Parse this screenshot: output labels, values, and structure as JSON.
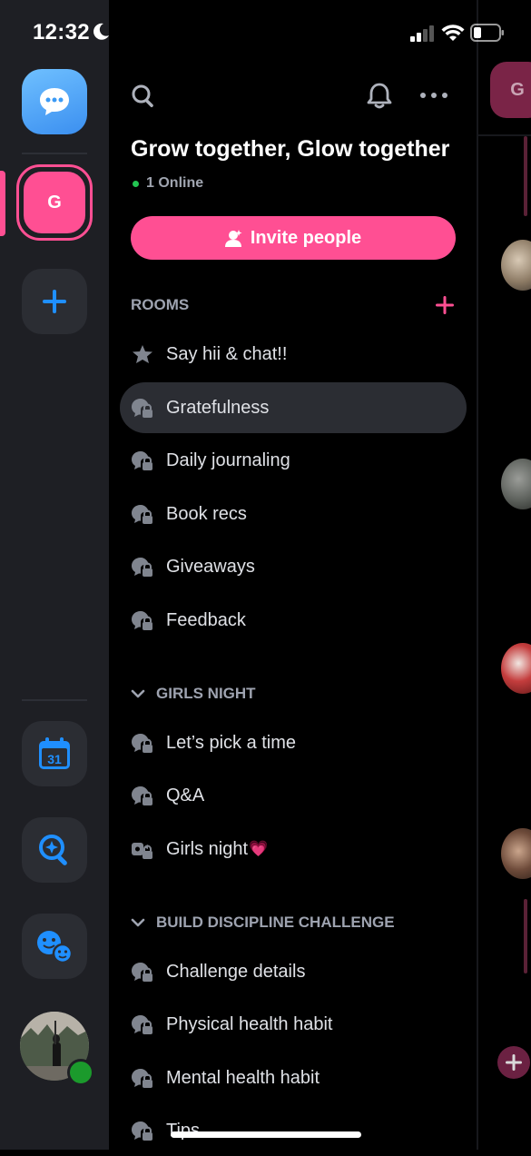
{
  "status_bar": {
    "time": "12:32"
  },
  "rail": {
    "server_initial": "G",
    "calendar_day": "31",
    "colors": {
      "accent": "#ff4f93",
      "blue": "#1f8fff",
      "online": "#1b9a2c"
    }
  },
  "header": {
    "server_name": "Grow together, Glow together",
    "online_text": "1 Online",
    "invite_label": "Invite people"
  },
  "sections": {
    "rooms": "ROOMS",
    "girls_night": "GIRLS NIGHT",
    "build_discipline": "BUILD DISCIPLINE CHALLENGE"
  },
  "rooms": [
    {
      "label": "Say hii & chat!!",
      "icon": "star-icon"
    },
    {
      "label": "Gratefulness",
      "icon": "chat-lock-icon",
      "active": true
    },
    {
      "label": "Daily journaling",
      "icon": "chat-lock-icon"
    },
    {
      "label": "Book recs",
      "icon": "chat-lock-icon"
    },
    {
      "label": "Giveaways",
      "icon": "chat-lock-icon"
    },
    {
      "label": "Feedback",
      "icon": "chat-lock-icon"
    }
  ],
  "girls_night_rooms": [
    {
      "label": "Let’s pick a time",
      "icon": "chat-lock-icon"
    },
    {
      "label": "Q&A",
      "icon": "chat-lock-icon"
    },
    {
      "label": "Girls night",
      "icon": "video-lock-icon",
      "emoji": "💗"
    }
  ],
  "discipline_rooms": [
    {
      "label": "Challenge details",
      "icon": "chat-lock-icon"
    },
    {
      "label": "Physical health habit",
      "icon": "chat-lock-icon"
    },
    {
      "label": "Mental health habit",
      "icon": "chat-lock-icon"
    },
    {
      "label": "Tips",
      "icon": "chat-lock-icon"
    }
  ],
  "right_panel": {
    "server_initial": "G"
  }
}
